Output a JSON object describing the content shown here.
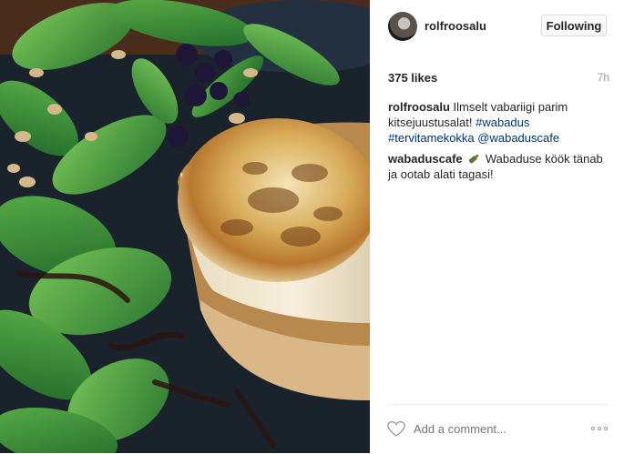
{
  "post": {
    "photo_alt": "Goat cheese salad",
    "author": "rolfroosalu",
    "follow_label": "Following",
    "likes": "375 likes",
    "time": "7h",
    "comments": [
      {
        "user": "rolfroosalu",
        "text_before": "Ilmselt vabariigi parim kitsejuustusalat! ",
        "hashtag1": "#wabadus",
        "hashtag2": "#tervitamekokka",
        "mention": "@wabaduscafe"
      },
      {
        "user": "wabaduscafe",
        "emoji": "bottle-icon",
        "text": " Wabaduse köök tänab ja ootab alati tagasi!"
      }
    ],
    "comment_placeholder": "Add a comment...",
    "icons": {
      "like": "heart-icon",
      "more": "more-options-icon"
    }
  },
  "colors": {
    "link": "#003569",
    "muted": "#999999",
    "button_bg": "#fafafa"
  }
}
